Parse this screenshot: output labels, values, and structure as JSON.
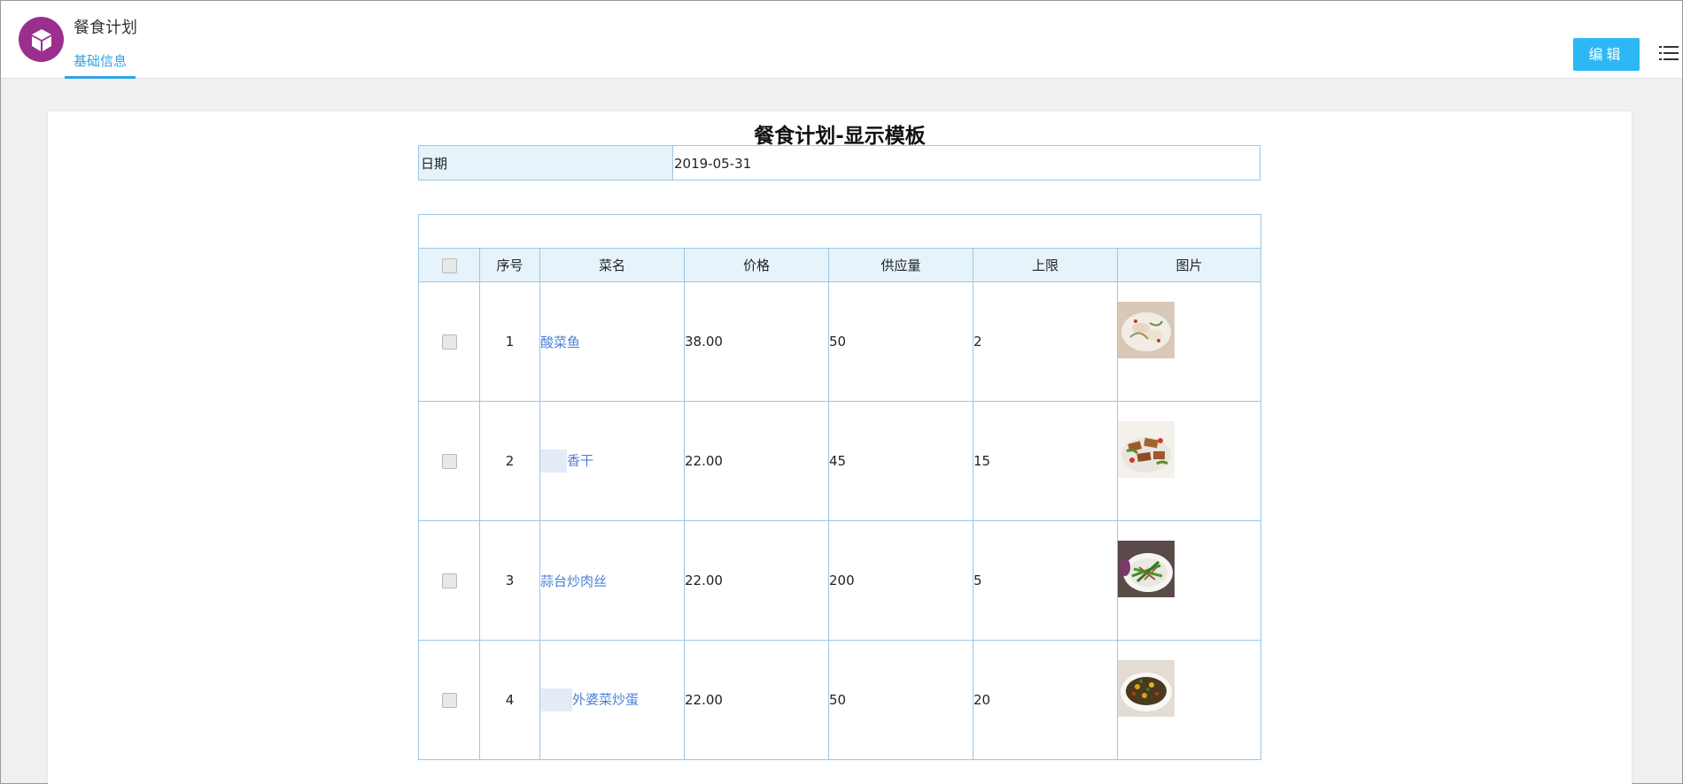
{
  "app": {
    "title": "餐食计划",
    "logo_icon": "cube-icon",
    "brand_color": "#9a2f8e",
    "tabs": [
      {
        "label": "基础信息",
        "active": true
      }
    ],
    "edit_label": "编辑",
    "menu_icon": "list-menu-icon",
    "accent_color": "#2fa4e7"
  },
  "page": {
    "title": "餐食计划-显示模板",
    "date_label": "日期",
    "date_value": "2019-05-31"
  },
  "table": {
    "headers": [
      "序号",
      "菜名",
      "价格",
      "供应量",
      "上限",
      "图片"
    ],
    "rows": [
      {
        "index": "1",
        "name": "酸菜鱼",
        "price": "38.00",
        "supply": "50",
        "limit": "2",
        "image": "fish-dish-photo",
        "name_masked": false
      },
      {
        "index": "2",
        "name": "香干",
        "price": "22.00",
        "supply": "45",
        "limit": "15",
        "image": "tofu-dish-photo",
        "name_masked": true
      },
      {
        "index": "3",
        "name": "蒜台炒肉丝",
        "price": "22.00",
        "supply": "200",
        "limit": "5",
        "image": "garlic-pork-photo",
        "name_masked": false
      },
      {
        "index": "4",
        "name": "外婆菜炒蛋",
        "price": "22.00",
        "supply": "50",
        "limit": "20",
        "image": "egg-dish-photo",
        "name_masked": true
      }
    ]
  }
}
